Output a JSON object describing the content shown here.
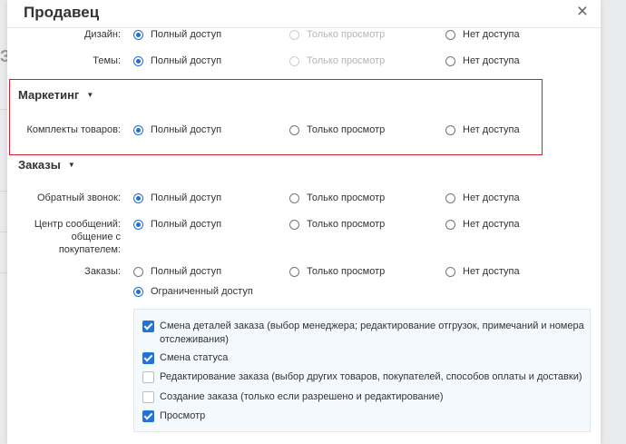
{
  "background": {
    "partial_text": "За"
  },
  "dialog": {
    "title": "Продавец",
    "close_symbol": "×"
  },
  "options": {
    "full": "Полный доступ",
    "view": "Только просмотр",
    "none": "Нет доступа",
    "limited": "Ограниченный доступ"
  },
  "rows": {
    "design": {
      "label": "Дизайн:",
      "selected": "full"
    },
    "themes": {
      "label": "Темы:",
      "selected": "full"
    },
    "bundles": {
      "label": "Комплекты товаров:",
      "selected": "full"
    },
    "callback": {
      "label": "Обратный звонок:",
      "selected": "full"
    },
    "messages": {
      "label_line1": "Центр сообщений:",
      "label_line2": "общение с",
      "label_line3": "покупателем:",
      "selected": "full"
    },
    "orders": {
      "label": "Заказы:",
      "selected": "limited"
    }
  },
  "sections": {
    "marketing": "Маркетинг",
    "orders": "Заказы"
  },
  "permissions": [
    {
      "line1": "Смена деталей заказа (выбор менеджера; редактирование отгрузок, примечаний и номера",
      "line2": "отслеживания)",
      "checked": true
    },
    {
      "line1": "Смена статуса",
      "checked": true
    },
    {
      "line1": "Редактирование заказа (выбор других товаров, покупателей, способов оплаты и доставки)",
      "checked": false
    },
    {
      "line1": "Создание заказа (только если разрешено и редактирование)",
      "checked": false
    },
    {
      "line1": "Просмотр",
      "checked": true
    }
  ],
  "colors": {
    "accent": "#1f6ed4",
    "highlight_border": "#d0202e",
    "panel_bg": "#f4f9fd"
  },
  "icons": {
    "close": "close-icon",
    "caret": "caret-down-icon",
    "checkbox": "checkbox-icon",
    "radio": "radio-icon"
  }
}
